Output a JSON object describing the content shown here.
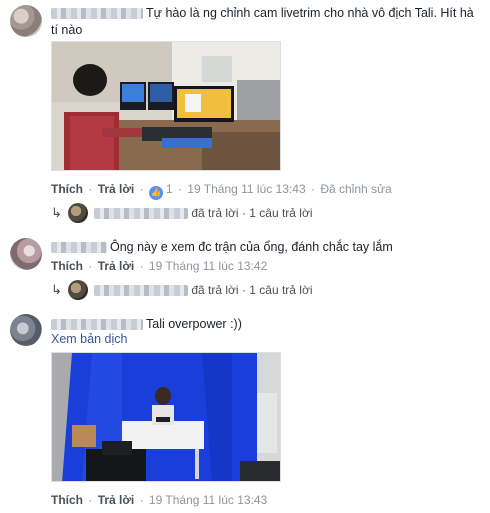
{
  "comments": [
    {
      "text": "Tự hào là ng chỉnh cam livetrim cho nhà vô địch Tali. Hít hà tí nào",
      "like_label": "Thích",
      "reply_label": "Trả lời",
      "reaction_count": "1",
      "timestamp": "19 Tháng 11 lúc 13:43",
      "edited": "Đã chỉnh sửa",
      "reply_summary": {
        "action": "đã trả lời",
        "count": "1 câu trả lời"
      }
    },
    {
      "text": "Ông này e xem đc trận của ổng, đánh chắc tay lắm",
      "like_label": "Thích",
      "reply_label": "Trả lời",
      "timestamp": "19 Tháng 11 lúc 13:42",
      "reply_summary": {
        "action": "đã trả lời",
        "count": "1 câu trả lời"
      }
    },
    {
      "text": "Tali overpower :))",
      "translate_label": "Xem bản dịch",
      "like_label": "Thích",
      "reply_label": "Trả lời",
      "timestamp": "19 Tháng 11 lúc 13:43"
    }
  ],
  "icons": {
    "like": "thumbs-up-icon",
    "reply_arrow": "reply-arrow-icon"
  },
  "colors": {
    "link": "#365899",
    "meta": "#90949c",
    "like_badge": "#5890ff",
    "greenscreen_blue": "#1a3ed9"
  }
}
